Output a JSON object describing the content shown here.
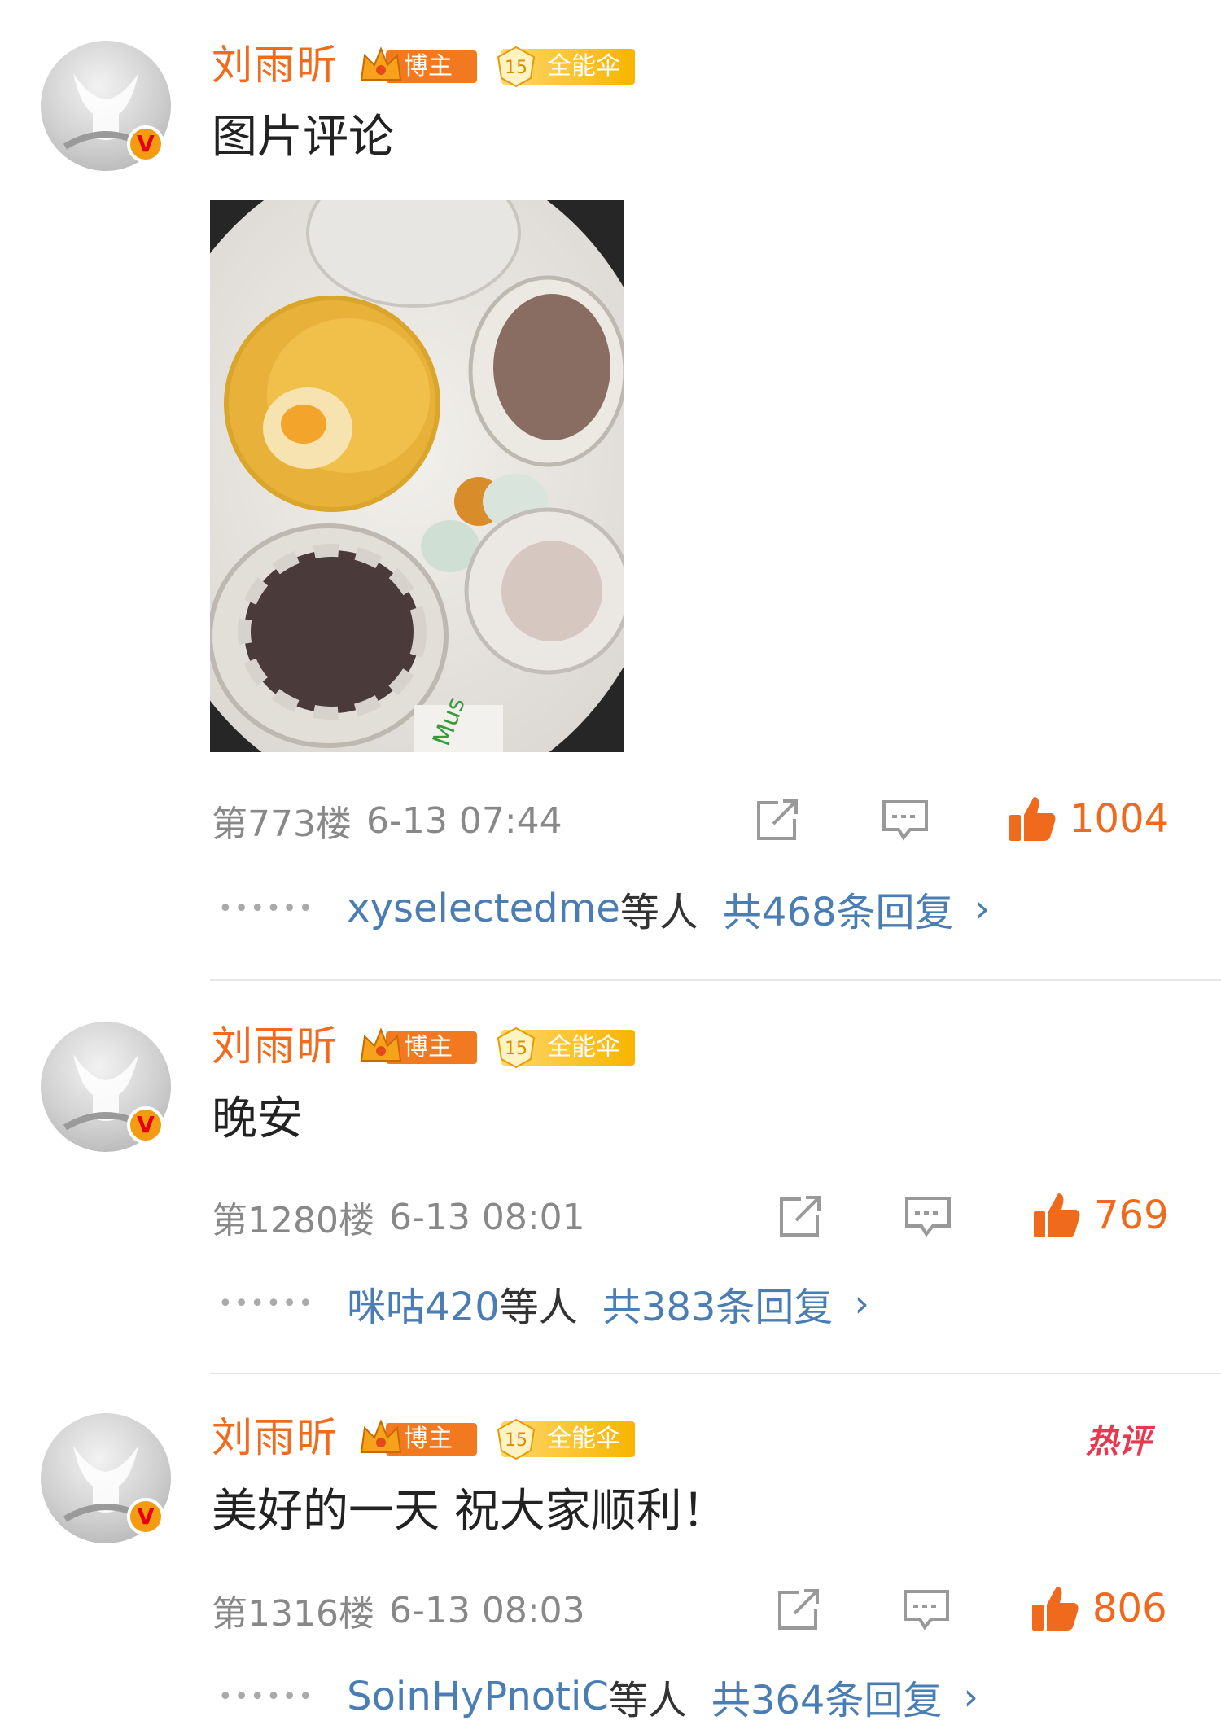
{
  "comments": [
    {
      "name": "刘雨昕",
      "badge_blogger": "博主",
      "badge_level": "15",
      "badge_fan": "全能伞",
      "verified": "V",
      "text": "图片评论",
      "floor": "第773楼",
      "time": "6-13 07:44",
      "likes": "1004",
      "reply_users": "xyselectedme",
      "reply_suffix": "等人",
      "reply_total": "共468条回复",
      "hot_label": ""
    },
    {
      "name": "刘雨昕",
      "badge_blogger": "博主",
      "badge_level": "15",
      "badge_fan": "全能伞",
      "verified": "V",
      "text": "晚安",
      "floor": "第1280楼",
      "time": "6-13 08:01",
      "likes": "769",
      "reply_users": "咪咕420",
      "reply_suffix": "等人",
      "reply_total": "共383条回复",
      "hot_label": ""
    },
    {
      "name": "刘雨昕",
      "badge_blogger": "博主",
      "badge_level": "15",
      "badge_fan": "全能伞",
      "verified": "V",
      "text": "美好的一天 祝大家顺利！",
      "floor": "第1316楼",
      "time": "6-13 08:03",
      "likes": "806",
      "reply_users": "SoinHyPnotiC",
      "reply_suffix": "等人",
      "reply_total": "共364条回复",
      "hot_label": "热评"
    }
  ],
  "colors": {
    "name_orange": "#f26b1d",
    "link_blue": "#4a7db3",
    "meta_gray": "#888888",
    "like_orange": "#f06a1d",
    "hot_red": "#e8384f"
  },
  "icons": {
    "share": "share-icon",
    "comment": "comment-icon",
    "like": "thumbs-up-icon",
    "chevron": "chevron-right-icon"
  }
}
